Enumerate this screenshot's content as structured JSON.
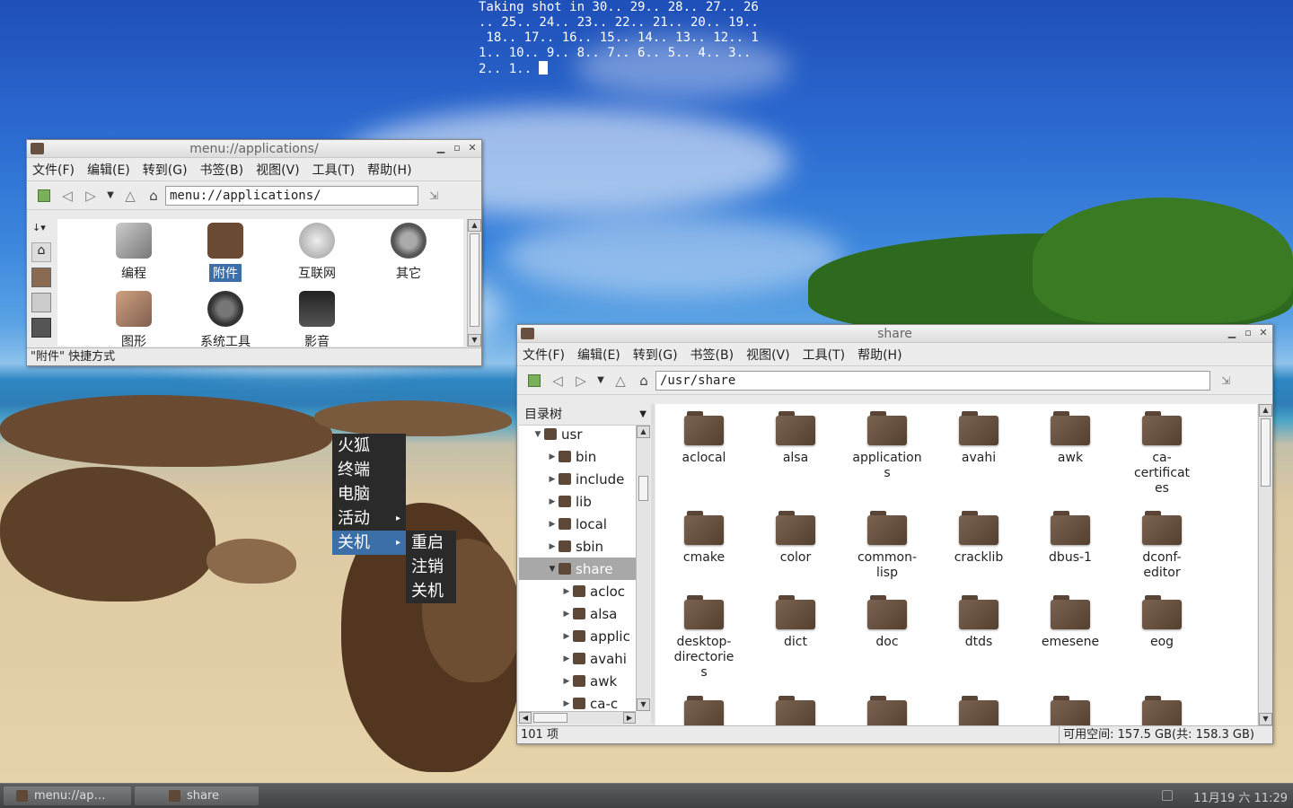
{
  "terminal": {
    "lines": [
      "Taking shot in 30.. 29.. 28.. 27.. 26",
      ".. 25.. 24.. 23.. 22.. 21.. 20.. 19..",
      " 18.. 17.. 16.. 15.. 14.. 13.. 12.. 1",
      "1.. 10.. 9.. 8.. 7.. 6.. 5.. 4.. 3..",
      "2.. 1.. "
    ]
  },
  "win1": {
    "title": "menu://applications/",
    "menu": [
      "文件(F)",
      "编辑(E)",
      "转到(G)",
      "书签(B)",
      "视图(V)",
      "工具(T)",
      "帮助(H)"
    ],
    "address": "menu://applications/",
    "side_arrow": "↓▾",
    "apps": [
      {
        "label": "编程",
        "color": "#a8a8a8"
      },
      {
        "label": "附件",
        "color": "#6b4a33",
        "selected": true
      },
      {
        "label": "互联网",
        "color": "#bdbdbd"
      },
      {
        "label": "其它",
        "color": "#707070"
      },
      {
        "label": "图形",
        "color": "#b08060"
      },
      {
        "label": "系统工具",
        "color": "#555555"
      },
      {
        "label": "影音",
        "color": "#444444"
      }
    ],
    "status": "\"附件\" 快捷方式"
  },
  "win2": {
    "title": "share",
    "menu": [
      "文件(F)",
      "编辑(E)",
      "转到(G)",
      "书签(B)",
      "视图(V)",
      "工具(T)",
      "帮助(H)"
    ],
    "address": "/usr/share",
    "tree_header": "目录树",
    "tree": [
      {
        "label": "usr",
        "indent": 0,
        "arrow": "▼"
      },
      {
        "label": "bin",
        "indent": 1,
        "arrow": "▶"
      },
      {
        "label": "include",
        "indent": 1,
        "arrow": "▶"
      },
      {
        "label": "lib",
        "indent": 1,
        "arrow": "▶"
      },
      {
        "label": "local",
        "indent": 1,
        "arrow": "▶"
      },
      {
        "label": "sbin",
        "indent": 1,
        "arrow": "▶"
      },
      {
        "label": "share",
        "indent": 1,
        "arrow": "▼",
        "selected": true
      },
      {
        "label": "acloc",
        "indent": 2,
        "arrow": "▶"
      },
      {
        "label": "alsa",
        "indent": 2,
        "arrow": "▶"
      },
      {
        "label": "applic",
        "indent": 2,
        "arrow": "▶"
      },
      {
        "label": "avahi",
        "indent": 2,
        "arrow": "▶"
      },
      {
        "label": "awk",
        "indent": 2,
        "arrow": "▶"
      },
      {
        "label": "ca-c",
        "indent": 2,
        "arrow": "▶"
      }
    ],
    "files": [
      "aclocal",
      "alsa",
      "application\ns",
      "avahi",
      "awk",
      "ca-\ncertificat\nes",
      "cmake",
      "color",
      "common-\nlisp",
      "cracklib",
      "dbus-1",
      "dconf-\neditor",
      "desktop-\ndirectorie\ns",
      "dict",
      "doc",
      "dtds",
      "emesene",
      "eog",
      "",
      "",
      "",
      "",
      "",
      ""
    ],
    "status_left": "101 项",
    "status_right": "可用空间: 157.5 GB(共: 158.3 GB)"
  },
  "context_menu": {
    "items": [
      {
        "label": "火狐"
      },
      {
        "label": "终端"
      },
      {
        "label": "电脑"
      },
      {
        "label": "活动",
        "submenu": true
      },
      {
        "label": "关机",
        "submenu": true,
        "selected": true
      }
    ],
    "submenu": [
      "重启",
      "注销",
      "关机"
    ],
    "submenu_arrow": "▸"
  },
  "taskbar": {
    "tasks": [
      "menu://ap…",
      "share"
    ],
    "clock": "11月19 六 11:29"
  },
  "colors": {
    "selection": "#3c6ea8",
    "taskbar": "#4a4d4e",
    "window_bg": "#eaeaea"
  }
}
